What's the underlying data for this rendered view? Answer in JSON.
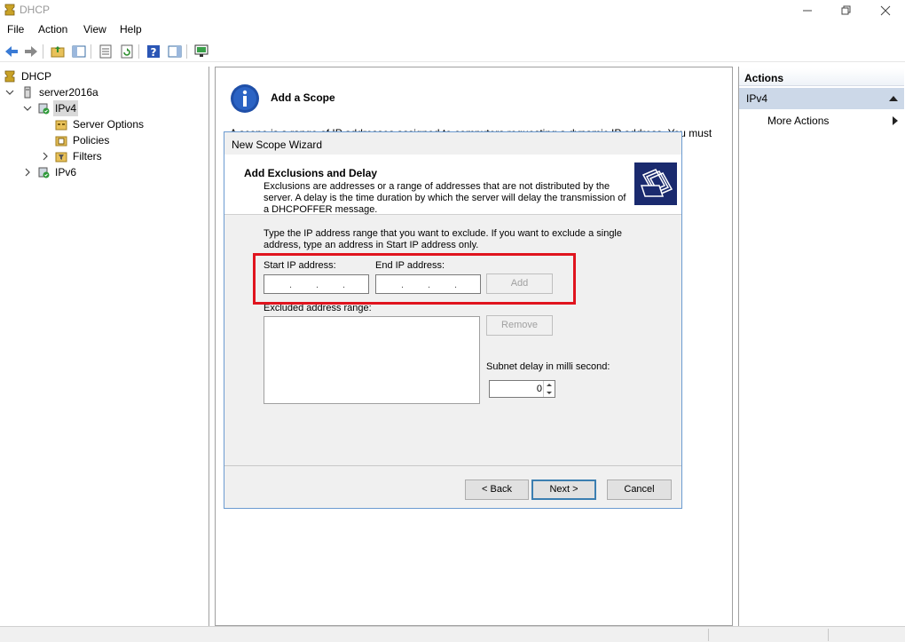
{
  "window": {
    "title": "DHCP"
  },
  "menu": [
    "File",
    "Action",
    "View",
    "Help"
  ],
  "toolbar": {
    "icons": [
      "back-arrow-icon",
      "forward-arrow-icon",
      "up-folder-icon",
      "show-hide-tree-icon",
      "properties-icon",
      "refresh-icon",
      "help-icon",
      "show-hide-action-pane-icon",
      "monitor-icon"
    ]
  },
  "tree": {
    "root": "DHCP",
    "server": "server2016a",
    "ipv4": "IPv4",
    "server_options": "Server Options",
    "policies": "Policies",
    "filters": "Filters",
    "ipv6": "IPv6"
  },
  "middle": {
    "title": "Add a Scope",
    "description": "A scope is a range of IP addresses assigned to computers requesting a dynamic IP address. You must"
  },
  "wizard": {
    "title": "New Scope Wizard",
    "header_title": "Add Exclusions and Delay",
    "header_desc": "Exclusions are addresses or a range of addresses that are not distributed by the server. A delay is the time duration by which the server will delay the transmission of a DHCPOFFER message.",
    "body_text": "Type the IP address range that you want to exclude. If you want to exclude a single address, type an address in Start IP address only.",
    "start_ip_label": "Start IP address:",
    "end_ip_label": "End IP address:",
    "add_button": "Add",
    "excluded_label": "Excluded address range:",
    "remove_button": "Remove",
    "subnet_delay_label": "Subnet delay in milli second:",
    "subnet_delay_value": "0",
    "back_button": "< Back",
    "next_button": "Next >",
    "cancel_button": "Cancel"
  },
  "actions": {
    "header": "Actions",
    "section": "IPv4",
    "more_actions": "More Actions"
  },
  "colors": {
    "highlight_red": "#e0141e",
    "actions_selected": "#ccd8e8",
    "wizard_icon_bg": "#1a2a6e"
  }
}
